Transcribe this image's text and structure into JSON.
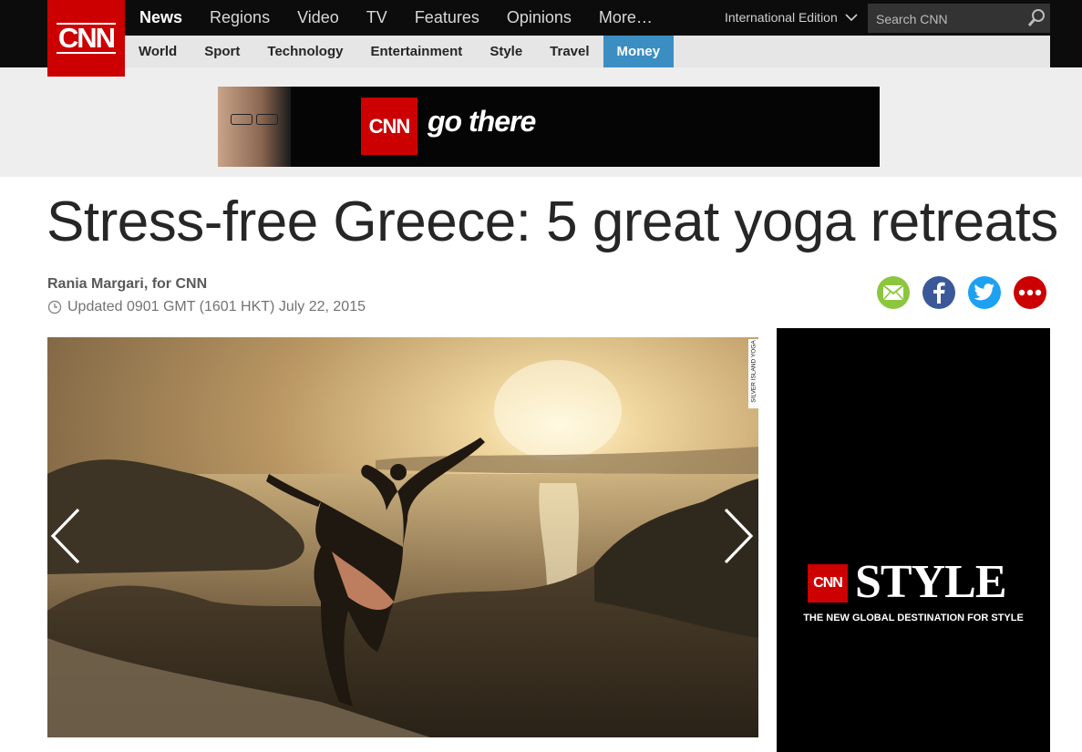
{
  "brand": {
    "logo_text": "CNN",
    "color": "#cc0000"
  },
  "primary_nav": [
    {
      "label": "News",
      "active": true
    },
    {
      "label": "Regions"
    },
    {
      "label": "Video"
    },
    {
      "label": "TV"
    },
    {
      "label": "Features"
    },
    {
      "label": "Opinions"
    },
    {
      "label": "More…"
    }
  ],
  "edition": {
    "label": "International Edition",
    "icon": "chevron-down-icon"
  },
  "search": {
    "placeholder": "Search CNN",
    "icon": "search-icon"
  },
  "secondary_nav": [
    {
      "label": "World"
    },
    {
      "label": "Sport"
    },
    {
      "label": "Technology"
    },
    {
      "label": "Entertainment"
    },
    {
      "label": "Style"
    },
    {
      "label": "Travel"
    },
    {
      "label": "Money",
      "active": true
    }
  ],
  "banner_ad": {
    "logo_text": "CNN",
    "tagline": "go there"
  },
  "article": {
    "headline": "Stress-free Greece: 5 great yoga retreats",
    "byline": "Rania Margari, for CNN",
    "updated": "Updated 0901 GMT (1601 HKT) July 22, 2015"
  },
  "share": [
    {
      "name": "email",
      "icon": "email-icon",
      "color": "#8cc63f"
    },
    {
      "name": "facebook",
      "icon": "facebook-icon",
      "color": "#3b5998"
    },
    {
      "name": "twitter",
      "icon": "twitter-icon",
      "color": "#1da1f2"
    },
    {
      "name": "more",
      "icon": "more-icon",
      "color": "#cc0000"
    }
  ],
  "gallery": {
    "photo_credit": "SILVER ISLAND YOGA"
  },
  "side_ad": {
    "logo_text": "CNN",
    "title": "STYLE",
    "subtitle": "THE NEW GLOBAL DESTINATION FOR STYLE"
  }
}
